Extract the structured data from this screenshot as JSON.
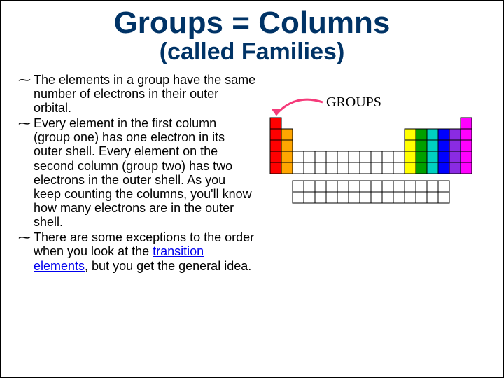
{
  "title": "Groups = Columns",
  "subtitle": "(called Families)",
  "bullets": [
    {
      "prefix": "The elements in a group have the same number of electrons in their outer orbital.",
      "link_text": "",
      "suffix": ""
    },
    {
      "prefix": "Every element in the first column (group one) has one electron in its outer shell. Every element on the second column (group two) has two electrons in the outer shell. As you keep counting the columns, you'll know how many electrons are in the outer shell.",
      "link_text": "",
      "suffix": ""
    },
    {
      "prefix": "There are some exceptions to the order when you look at the ",
      "link_text": "transition elements",
      "suffix": ", but you get the general idea."
    }
  ],
  "figure": {
    "label": "GROUPS",
    "arrow_color": "#f53b7a",
    "columns": [
      {
        "color": "#ff0000",
        "top_start": 0,
        "top_len": 3
      },
      {
        "color": "#ffa500",
        "top_start": 1,
        "top_len": 2
      },
      {
        "color": "#ffff00",
        "top_start": 1,
        "top_len": 2
      },
      {
        "color": "#00a000",
        "top_start": 1,
        "top_len": 2
      },
      {
        "color": "#00d0c0",
        "top_start": 1,
        "top_len": 2
      },
      {
        "color": "#0000ff",
        "top_start": 1,
        "top_len": 2
      },
      {
        "color": "#8a2be2",
        "top_start": 1,
        "top_len": 2
      },
      {
        "color": "#ff00ff",
        "top_start": 0,
        "top_len": 3
      }
    ],
    "bottom_rows": 2,
    "bottom_cols": 14,
    "main_white_cols": [
      2,
      3,
      4,
      5,
      6,
      7,
      8,
      9,
      10,
      11
    ],
    "main_white_row_start": 3,
    "main_white_row_len": 2
  }
}
